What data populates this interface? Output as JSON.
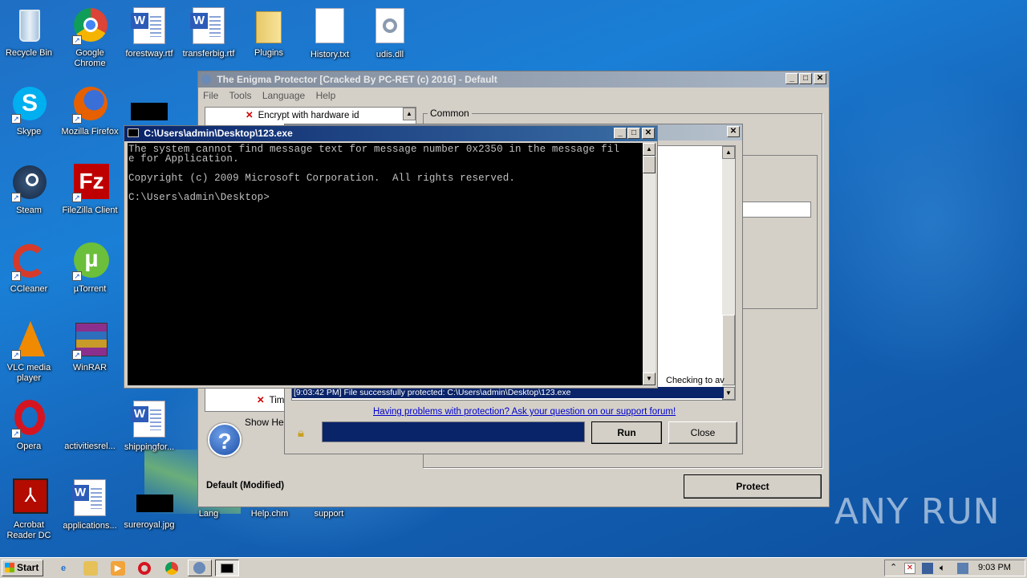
{
  "desktop": {
    "icons": [
      {
        "label": "Recycle Bin"
      },
      {
        "label": "Google Chrome"
      },
      {
        "label": "forestway.rtf"
      },
      {
        "label": "transferbig.rtf"
      },
      {
        "label": "Plugins"
      },
      {
        "label": "History.txt"
      },
      {
        "label": "udis.dll"
      },
      {
        "label": "Skype"
      },
      {
        "label": "Mozilla Firefox"
      },
      {
        "label": "Steam"
      },
      {
        "label": "FileZilla Client"
      },
      {
        "label": "CCleaner"
      },
      {
        "label": "µTorrent"
      },
      {
        "label": "VLC media player"
      },
      {
        "label": "WinRAR"
      },
      {
        "label": "Opera"
      },
      {
        "label": "activitiesrel..."
      },
      {
        "label": "shippingfor..."
      },
      {
        "label": "Acrobat Reader DC"
      },
      {
        "label": "applications..."
      },
      {
        "label": "sureroyal.jpg"
      },
      {
        "label": "Lang"
      },
      {
        "label": "Help.chm"
      },
      {
        "label": "support"
      }
    ]
  },
  "enigma": {
    "title": "The Enigma Protector [Cracked By PC-RET (c) 2016] - Default",
    "menu": [
      "File",
      "Tools",
      "Language",
      "Help"
    ],
    "tree_item_top": "Encrypt with hardware id",
    "tree_item_bottom": "Tim",
    "group_label": "Common",
    "show_help": "Show Help",
    "status": "Default  (Modified)",
    "protect_button": "Protect"
  },
  "protect_dialog": {
    "log_checking": "Checking to av",
    "log_selected": "[9:03:42 PM] File successfully protected: C:\\Users\\admin\\Desktop\\123.exe",
    "support_link": "Having problems with protection? Ask your question on our support forum!",
    "run_button": "Run",
    "close_button": "Close"
  },
  "console": {
    "title": "C:\\Users\\admin\\Desktop\\123.exe",
    "line1": "The system cannot find message text for message number 0x2350 in the message fil",
    "line2": "e for Application.",
    "line3": "Copyright (c) 2009 Microsoft Corporation.  All rights reserved.",
    "line4": "C:\\Users\\admin\\Desktop>"
  },
  "taskbar": {
    "start_label": "Start",
    "clock": "9:03 PM"
  },
  "watermark": "ANY RUN"
}
